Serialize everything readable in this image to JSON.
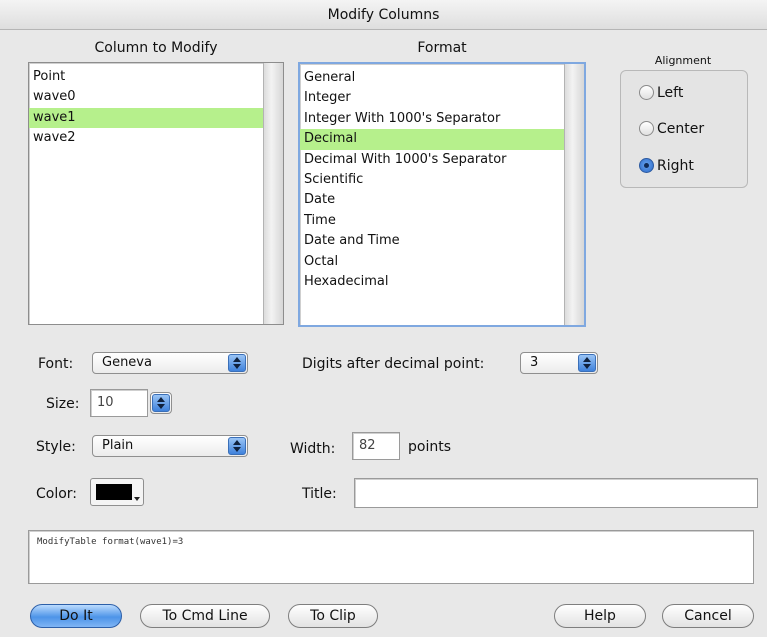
{
  "window": {
    "title": "Modify Columns"
  },
  "column_section": {
    "heading": "Column to Modify",
    "items": [
      "Point",
      "wave0",
      "wave1",
      "wave2"
    ],
    "selected_index": 2
  },
  "format_section": {
    "heading": "Format",
    "items": [
      "General",
      "Integer",
      "Integer With 1000's Separator",
      "Decimal",
      "Decimal With 1000's Separator",
      "Scientific",
      "Date",
      "Time",
      "Date and Time",
      "Octal",
      "Hexadecimal"
    ],
    "selected_index": 3
  },
  "alignment": {
    "heading": "Alignment",
    "options": [
      "Left",
      "Center",
      "Right"
    ],
    "selected": "Right"
  },
  "font": {
    "label": "Font:",
    "value": "Geneva"
  },
  "size": {
    "label": "Size:",
    "value": "10"
  },
  "style": {
    "label": "Style:",
    "value": "Plain"
  },
  "color": {
    "label": "Color:",
    "value": "#000000"
  },
  "digits": {
    "label": "Digits after decimal point:",
    "value": "3"
  },
  "width": {
    "label": "Width:",
    "value": "82",
    "unit": "points"
  },
  "title_field": {
    "label": "Title:",
    "value": ""
  },
  "command": {
    "text": "ModifyTable format(wave1)=3"
  },
  "buttons": {
    "do_it": "Do It",
    "to_cmd_line": "To Cmd Line",
    "to_clip": "To Clip",
    "help": "Help",
    "cancel": "Cancel"
  },
  "colors": {
    "selection": "#b6f08c",
    "accent": "#4d94e8"
  }
}
